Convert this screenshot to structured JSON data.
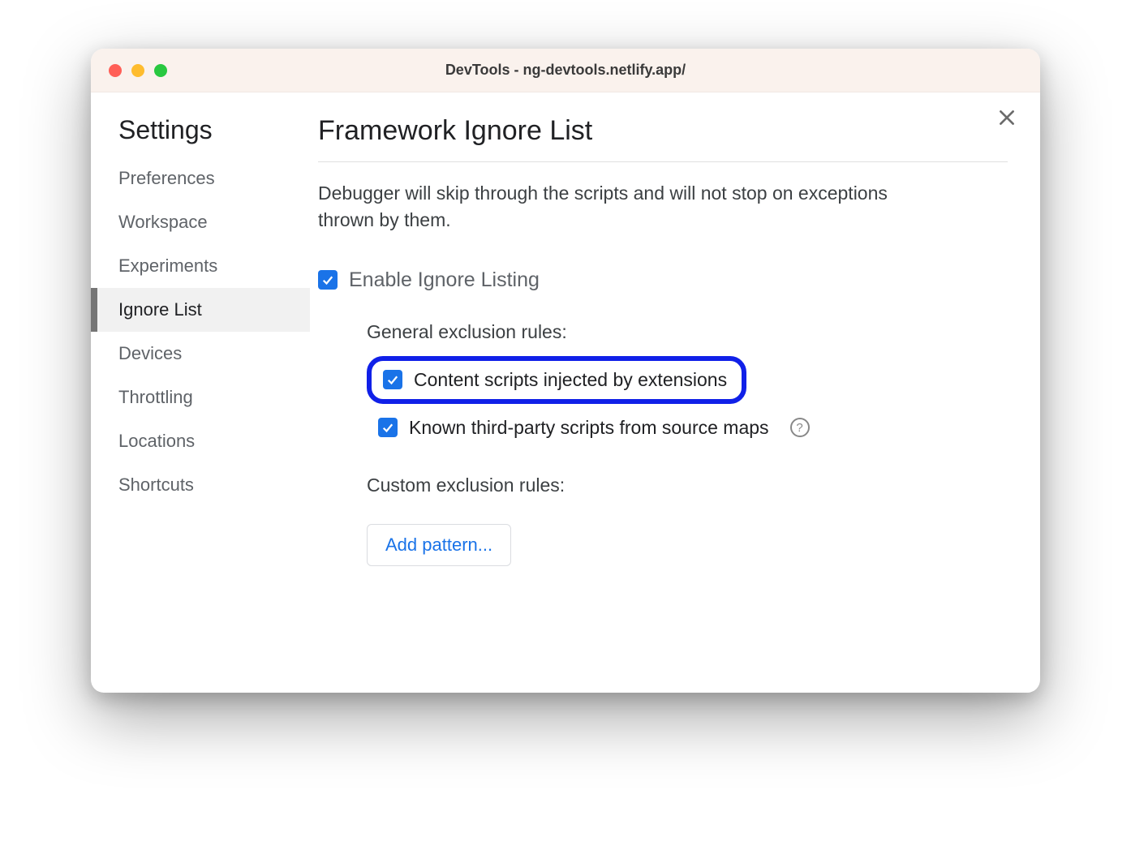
{
  "window": {
    "title": "DevTools - ng-devtools.netlify.app/"
  },
  "sidebar": {
    "heading": "Settings",
    "items": [
      {
        "label": "Preferences",
        "active": false
      },
      {
        "label": "Workspace",
        "active": false
      },
      {
        "label": "Experiments",
        "active": false
      },
      {
        "label": "Ignore List",
        "active": true
      },
      {
        "label": "Devices",
        "active": false
      },
      {
        "label": "Throttling",
        "active": false
      },
      {
        "label": "Locations",
        "active": false
      },
      {
        "label": "Shortcuts",
        "active": false
      }
    ]
  },
  "main": {
    "title": "Framework Ignore List",
    "description": "Debugger will skip through the scripts and will not stop on exceptions thrown by them.",
    "enable_label": "Enable Ignore Listing",
    "enable_checked": true,
    "general_rules_label": "General exclusion rules:",
    "rules": {
      "content_scripts": {
        "label": "Content scripts injected by extensions",
        "checked": true,
        "highlighted": true
      },
      "third_party": {
        "label": "Known third-party scripts from source maps",
        "checked": true,
        "has_help": true
      }
    },
    "custom_rules_label": "Custom exclusion rules:",
    "add_pattern_label": "Add pattern..."
  }
}
